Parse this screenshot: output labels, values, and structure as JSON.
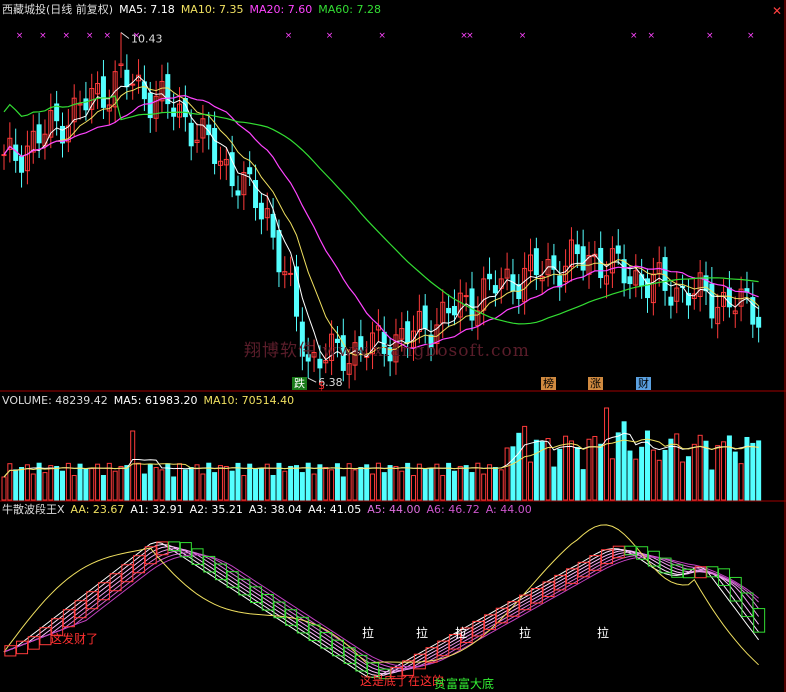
{
  "colors": {
    "up": "#ff3b3b",
    "down": "#54ffff",
    "ma5": "#ffffff",
    "ma10": "#f0e060",
    "ma20": "#ff44ff",
    "ma60": "#33dd33",
    "grid": "#a00000",
    "marker": "#ff44ff"
  },
  "price_panel": {
    "title": "西藏城投(日线 前复权)",
    "ma5": "MA5: 7.18",
    "ma10": "MA10: 7.35",
    "ma20": "MA20: 7.60",
    "ma60": "MA60: 7.28",
    "high_label": "10.43",
    "low_label": "6.38",
    "watermark": "翔博软件 www.xiangbosoft.com",
    "badges": [
      {
        "text": "跌",
        "bg": "#1a7a1a",
        "fg": "#ffffff"
      },
      {
        "text": "$",
        "bg": "#000000",
        "fg": "#ff3030"
      },
      {
        "text": "榜",
        "bg": "#d08a40",
        "fg": "#000000"
      },
      {
        "text": "涨",
        "bg": "#d08a40",
        "fg": "#000000"
      },
      {
        "text": "财",
        "bg": "#5aa0e0",
        "fg": "#000000"
      }
    ],
    "close_arrow_icon": "cross-arrow-icon"
  },
  "volume_panel": {
    "vol": "VOLUME: 48239.42",
    "ma5": "MA5: 61983.20",
    "ma10": "MA10: 70514.40"
  },
  "indicator_panel": {
    "name": "牛散波段王X",
    "aa": "AA: 23.67",
    "a1": "A1: 32.91",
    "a2": "A2: 35.21",
    "a3": "A3: 38.04",
    "a4": "A4: 41.05",
    "a5": "A5: 44.00",
    "a6": "A6: 46.72",
    "a": "A: 44.00",
    "pull_label": "拉",
    "note_left": "这发财了",
    "note_bottom_left": "这是底了在这的",
    "note_bottom_right": "贫富富大底"
  },
  "chart_data": [
    {
      "type": "candlestick",
      "title": "西藏城投(日线 前复权)",
      "count": 130,
      "ohlc_key_points": [
        {
          "i": 0,
          "close": 8.9
        },
        {
          "i": 20,
          "high": 10.43,
          "close": 9.9
        },
        {
          "i": 30,
          "close": 9.5
        },
        {
          "i": 45,
          "close": 8.3
        },
        {
          "i": 52,
          "low": 6.38,
          "close": 6.6
        },
        {
          "i": 60,
          "close": 6.7
        },
        {
          "i": 70,
          "close": 6.9
        },
        {
          "i": 85,
          "close": 7.5
        },
        {
          "i": 100,
          "close": 7.8
        },
        {
          "i": 110,
          "close": 7.5
        },
        {
          "i": 129,
          "close": 7.18
        }
      ],
      "ma_values_last": {
        "MA5": 7.18,
        "MA10": 7.35,
        "MA20": 7.6,
        "MA60": 7.28
      },
      "ylim": [
        6.3,
        10.6
      ]
    },
    {
      "type": "bar",
      "title": "VOLUME",
      "last": {
        "VOLUME": 48239.42,
        "MA5": 61983.2,
        "MA10": 70514.4
      }
    },
    {
      "type": "line",
      "title": "牛散波段王X",
      "last": {
        "AA": 23.67,
        "A1": 32.91,
        "A2": 35.21,
        "A3": 38.04,
        "A4": 41.05,
        "A5": 44.0,
        "A6": 46.72,
        "A": 44.0
      }
    }
  ]
}
